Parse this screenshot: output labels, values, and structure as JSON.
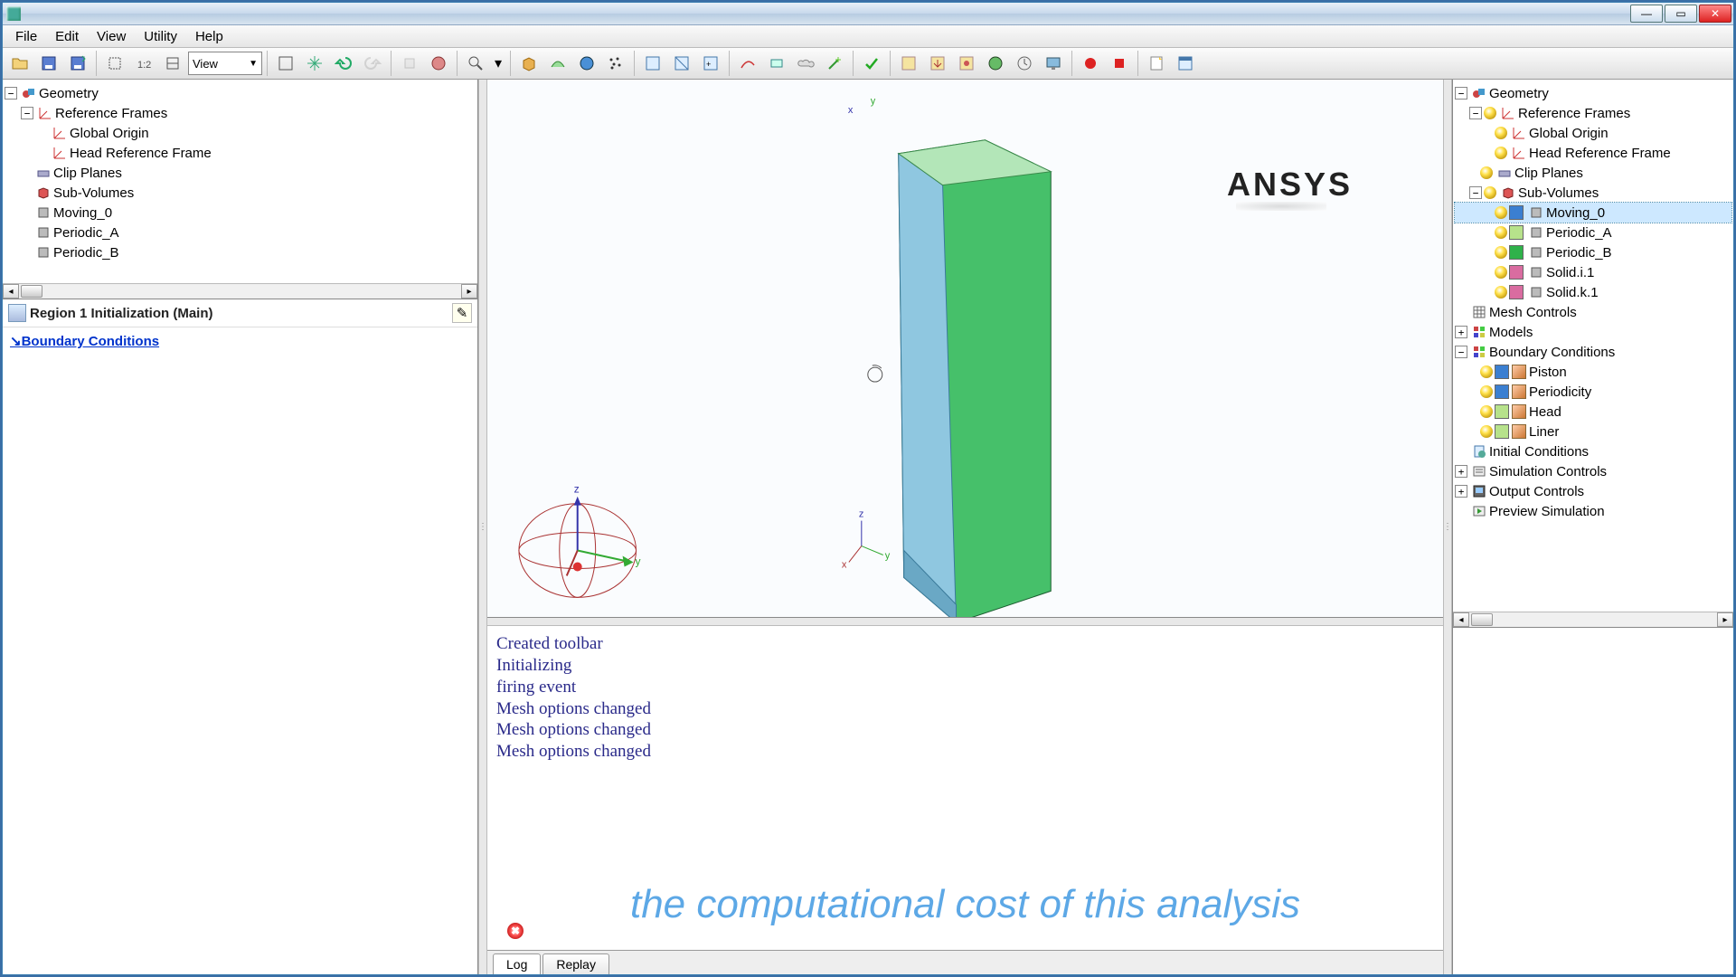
{
  "title": "",
  "menu": {
    "file": "File",
    "edit": "Edit",
    "view": "View",
    "utility": "Utility",
    "help": "Help"
  },
  "toolbar": {
    "view_select": "View"
  },
  "left_tree": {
    "root": "Geometry",
    "items": [
      {
        "label": "Reference Frames"
      },
      {
        "label": "Global Origin",
        "indent": 1
      },
      {
        "label": "Head Reference Frame",
        "indent": 1
      },
      {
        "label": "Clip Planes"
      },
      {
        "label": "Sub-Volumes"
      },
      {
        "label": "Moving_0",
        "indent": 1,
        "icon": "box"
      },
      {
        "label": "Periodic_A",
        "indent": 1,
        "icon": "box"
      },
      {
        "label": "Periodic_B",
        "indent": 1,
        "icon": "box"
      }
    ]
  },
  "props": {
    "header": "Region 1 Initialization (Main)",
    "link": "Boundary Conditions"
  },
  "viewport_brand": "ANSYS",
  "right_tree": {
    "root": "Geometry",
    "ref": "Reference Frames",
    "ref_items": [
      "Global Origin",
      "Head Reference Frame"
    ],
    "clip": "Clip Planes",
    "sub": "Sub-Volumes",
    "sub_items": [
      {
        "label": "Moving_0",
        "color": "#3b7fd1",
        "sel": true
      },
      {
        "label": "Periodic_A",
        "color": "#b7e28b"
      },
      {
        "label": "Periodic_B",
        "color": "#2fb24a"
      },
      {
        "label": "Solid.i.1",
        "color": "#d96ca0"
      },
      {
        "label": "Solid.k.1",
        "color": "#d96ca0"
      }
    ],
    "mesh": "Mesh Controls",
    "models": "Models",
    "bc": "Boundary Conditions",
    "bc_items": [
      {
        "label": "Piston",
        "color": "#3b7fd1"
      },
      {
        "label": "Periodicity",
        "color": "#3b7fd1"
      },
      {
        "label": "Head",
        "color": "#b7e28b"
      },
      {
        "label": "Liner",
        "color": "#b7e28b"
      }
    ],
    "init": "Initial Conditions",
    "sim": "Simulation Controls",
    "out": "Output Controls",
    "prev": "Preview Simulation"
  },
  "log": [
    "Created toolbar",
    "Initializing",
    "firing event",
    "Mesh options changed",
    "Mesh options changed",
    "Mesh options changed"
  ],
  "tabs": {
    "log": "Log",
    "replay": "Replay"
  },
  "caption": "the computational cost of this analysis"
}
